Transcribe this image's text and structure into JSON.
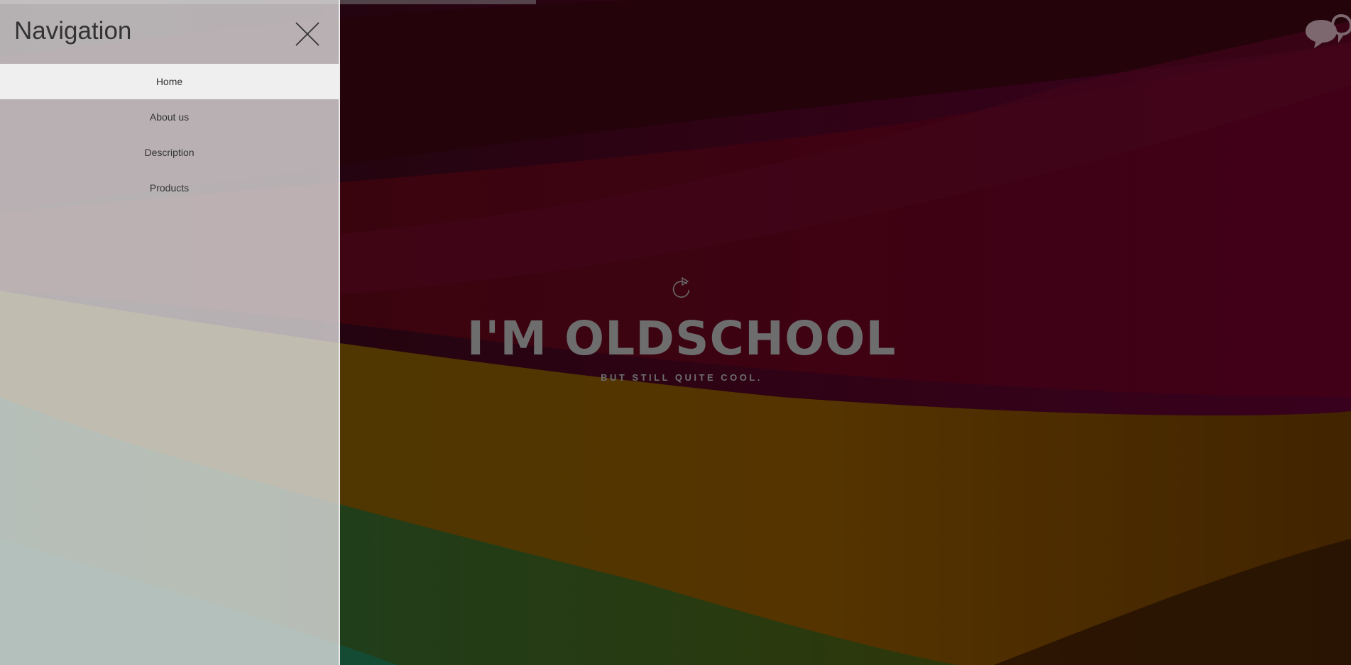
{
  "nav": {
    "title": "Navigation",
    "items": [
      {
        "label": "Home",
        "active": true
      },
      {
        "label": "About us",
        "active": false
      },
      {
        "label": "Description",
        "active": false
      },
      {
        "label": "Products",
        "active": false
      }
    ]
  },
  "hero": {
    "title": "I'M OLDSCHOOL",
    "subtitle": "BUT STILL QUITE COOL."
  },
  "icons": {
    "close": "close-icon",
    "reload": "reload-icon",
    "chat": "chat-bubbles-icon"
  },
  "colors": {
    "panel_bg": "#e1e1e1",
    "active_item_bg": "#f2f2f2",
    "text_dark": "#333333",
    "hero_text": "#6d6d6d"
  }
}
